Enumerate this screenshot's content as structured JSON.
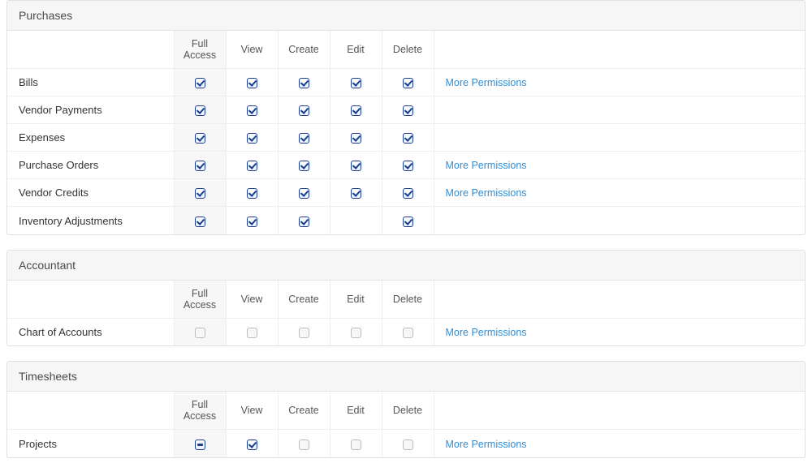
{
  "columns": [
    "",
    "Full Access",
    "View",
    "Create",
    "Edit",
    "Delete",
    ""
  ],
  "more_permissions_label": "More Permissions",
  "sections": [
    {
      "title": "Purchases",
      "rows": [
        {
          "label": "Bills",
          "cells": [
            "checked",
            "checked",
            "checked",
            "checked",
            "checked"
          ],
          "more": true
        },
        {
          "label": "Vendor Payments",
          "cells": [
            "checked",
            "checked",
            "checked",
            "checked",
            "checked"
          ],
          "more": false
        },
        {
          "label": "Expenses",
          "cells": [
            "checked",
            "checked",
            "checked",
            "checked",
            "checked"
          ],
          "more": false
        },
        {
          "label": "Purchase Orders",
          "cells": [
            "checked",
            "checked",
            "checked",
            "checked",
            "checked"
          ],
          "more": true
        },
        {
          "label": "Vendor Credits",
          "cells": [
            "checked",
            "checked",
            "checked",
            "checked",
            "checked"
          ],
          "more": true
        },
        {
          "label": "Inventory Adjustments",
          "cells": [
            "checked",
            "checked",
            "checked",
            "none",
            "checked"
          ],
          "more": false
        }
      ]
    },
    {
      "title": "Accountant",
      "rows": [
        {
          "label": "Chart of Accounts",
          "cells": [
            "empty",
            "empty",
            "empty",
            "empty",
            "empty"
          ],
          "more": true
        }
      ]
    },
    {
      "title": "Timesheets",
      "rows": [
        {
          "label": "Projects",
          "cells": [
            "indet",
            "checked",
            "empty",
            "empty",
            "empty"
          ],
          "more": true
        }
      ]
    }
  ]
}
